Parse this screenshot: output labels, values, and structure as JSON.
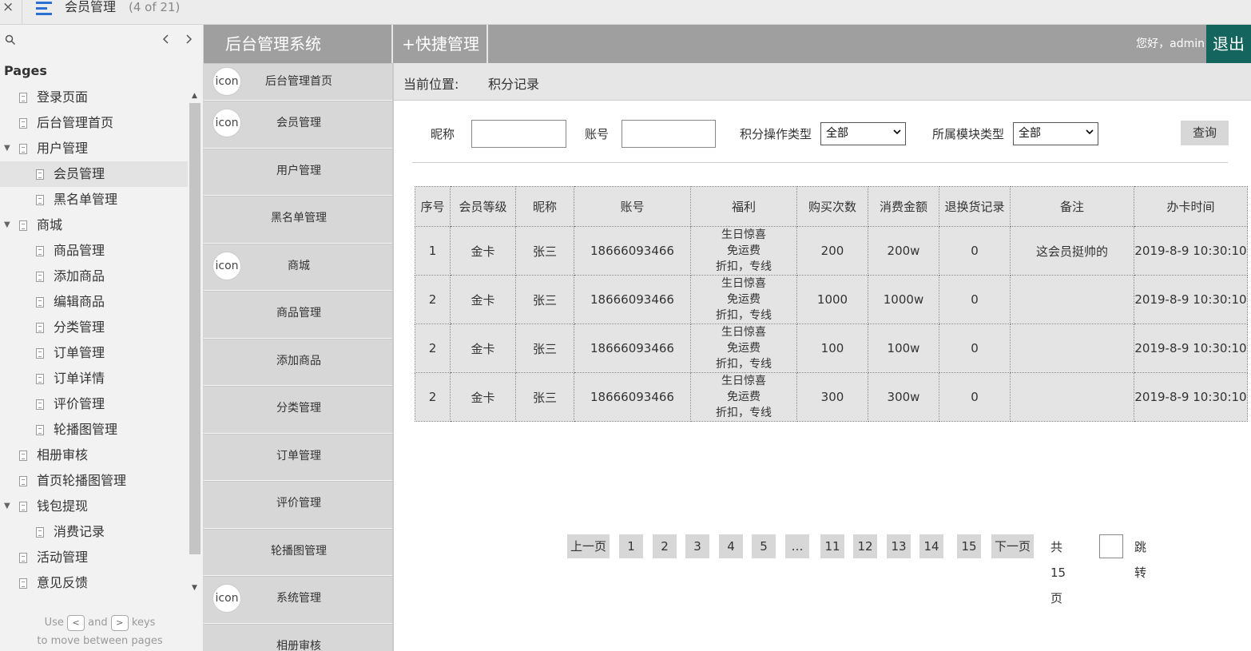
{
  "topbar": {
    "close": "×",
    "title": "会员管理",
    "count": "(4 of 21)"
  },
  "sidebar": {
    "search_icon": "search-icon",
    "pages_heading": "Pages",
    "items": [
      {
        "label": "登录页面",
        "level": 0,
        "caret": ""
      },
      {
        "label": "后台管理首页",
        "level": 0,
        "caret": ""
      },
      {
        "label": "用户管理",
        "level": 0,
        "caret": "▼"
      },
      {
        "label": "会员管理",
        "level": 1,
        "caret": "",
        "selected": true
      },
      {
        "label": "黑名单管理",
        "level": 1,
        "caret": ""
      },
      {
        "label": "商城",
        "level": 0,
        "caret": "▼"
      },
      {
        "label": "商品管理",
        "level": 1,
        "caret": ""
      },
      {
        "label": "添加商品",
        "level": 1,
        "caret": ""
      },
      {
        "label": "编辑商品",
        "level": 1,
        "caret": ""
      },
      {
        "label": "分类管理",
        "level": 1,
        "caret": ""
      },
      {
        "label": "订单管理",
        "level": 1,
        "caret": ""
      },
      {
        "label": "订单详情",
        "level": 1,
        "caret": ""
      },
      {
        "label": "评价管理",
        "level": 1,
        "caret": ""
      },
      {
        "label": "轮播图管理",
        "level": 1,
        "caret": ""
      },
      {
        "label": "相册审核",
        "level": 0,
        "caret": ""
      },
      {
        "label": "首页轮播图管理",
        "level": 0,
        "caret": ""
      },
      {
        "label": "钱包提现",
        "level": 0,
        "caret": "▼"
      },
      {
        "label": "消费记录",
        "level": 1,
        "caret": ""
      },
      {
        "label": "活动管理",
        "level": 0,
        "caret": ""
      },
      {
        "label": "意见反馈",
        "level": 0,
        "caret": ""
      }
    ],
    "hint": {
      "use": "Use",
      "key_left": "<",
      "and": "and",
      "key_right": ">",
      "keys": "keys",
      "line2": "to move between pages"
    }
  },
  "header": {
    "brand": "后台管理系统",
    "quick": "+快捷管理",
    "hello": "您好，admin",
    "logout": "退出"
  },
  "leftnav": [
    {
      "label": "后台管理首页",
      "icon": "icon"
    },
    {
      "label": "会员管理",
      "icon": "icon"
    },
    {
      "label": "用户管理",
      "icon": ""
    },
    {
      "label": "黑名单管理",
      "icon": ""
    },
    {
      "label": "商城",
      "icon": "icon"
    },
    {
      "label": "商品管理",
      "icon": ""
    },
    {
      "label": "添加商品",
      "icon": ""
    },
    {
      "label": "分类管理",
      "icon": ""
    },
    {
      "label": "订单管理",
      "icon": ""
    },
    {
      "label": "评价管理",
      "icon": ""
    },
    {
      "label": "轮播图管理",
      "icon": ""
    },
    {
      "label": "系统管理",
      "icon": "icon"
    },
    {
      "label": "相册审核",
      "icon": ""
    }
  ],
  "crumb": {
    "label": "当前位置:",
    "value": "积分记录"
  },
  "filters": {
    "nickname": "昵称",
    "account": "账号",
    "op_type": "积分操作类型",
    "op_value": "全部",
    "module_type": "所属模块类型",
    "module_value": "全部",
    "query": "查询"
  },
  "table": {
    "headers": [
      "序号",
      "会员等级",
      "昵称",
      "账号",
      "福利",
      "购买次数",
      "消费金额",
      "退换货记录",
      "备注",
      "办卡时间"
    ],
    "rows": [
      [
        "1",
        "金卡",
        "张三",
        "18666093466",
        "生日惊喜\n免运费\n折扣，专线",
        "200",
        "200w",
        "0",
        "这会员挺帅的",
        "2019-8-9 10:30:10"
      ],
      [
        "2",
        "金卡",
        "张三",
        "18666093466",
        "生日惊喜\n免运费\n折扣，专线",
        "1000",
        "1000w",
        "0",
        "",
        "2019-8-9 10:30:10"
      ],
      [
        "2",
        "金卡",
        "张三",
        "18666093466",
        "生日惊喜\n免运费\n折扣，专线",
        "100",
        "100w",
        "0",
        "",
        "2019-8-9 10:30:10"
      ],
      [
        "2",
        "金卡",
        "张三",
        "18666093466",
        "生日惊喜\n免运费\n折扣，专线",
        "300",
        "300w",
        "0",
        "",
        "2019-8-9 10:30:10"
      ]
    ]
  },
  "pager": {
    "prev": "上一页",
    "pages": [
      "1",
      "2",
      "3",
      "4",
      "5",
      "…",
      "11",
      "12",
      "13",
      "14",
      "15"
    ],
    "next": "下一页",
    "total": "共15页",
    "jump": "跳转"
  }
}
